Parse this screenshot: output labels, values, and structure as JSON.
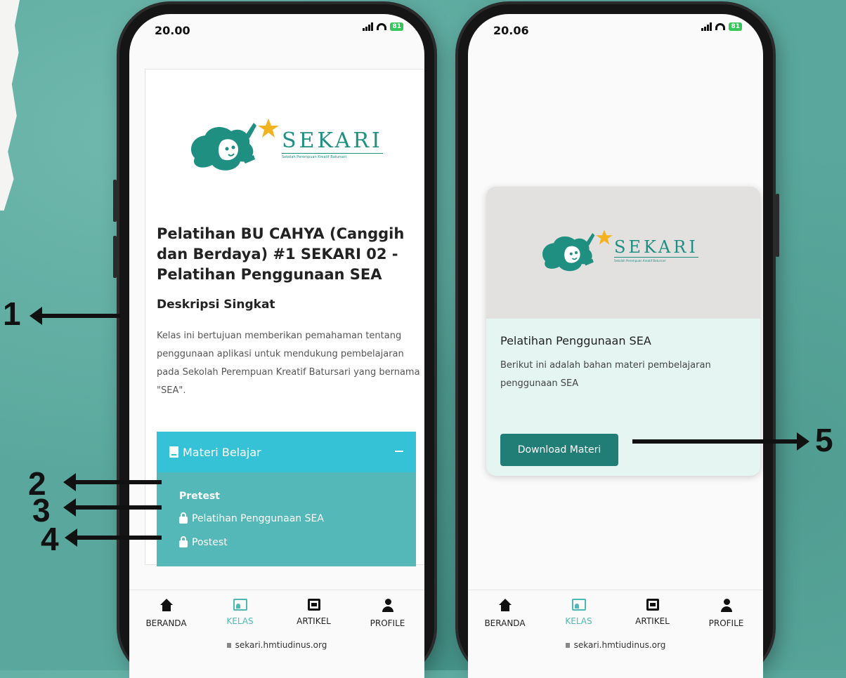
{
  "colors": {
    "background": "#5aa89d",
    "teal": "#1f8f82",
    "materi_head": "#36c2d6",
    "materi_body": "#55b8b8",
    "button": "#207e77",
    "active_nav": "#4fb8b0"
  },
  "left_phone": {
    "status_time": "20.00",
    "battery": "81",
    "logo": {
      "word": "SEKARI",
      "subtitle": "Sekolah Perempuan Kreatif Batursari"
    },
    "course_title": "Pelatihan BU CAHYA (Canggih dan Berdaya) #1 SEKARI 02 - Pelatihan Penggunaan SEA",
    "description_heading": "Deskripsi Singkat",
    "description_text": "Kelas ini bertujuan memberikan pemahaman tentang penggunaan aplikasi untuk mendukung pembelajaran pada Sekolah Perempuan Kreatif Batursari  yang bernama \"SEA\".",
    "materi": {
      "header": "Materi Belajar",
      "items": [
        {
          "label": "Pretest",
          "locked": false
        },
        {
          "label": "Pelatihan Penggunaan SEA",
          "locked": true
        },
        {
          "label": "Postest",
          "locked": true
        }
      ]
    }
  },
  "right_phone": {
    "status_time": "20.06",
    "battery": "81",
    "logo": {
      "word": "SEKARI",
      "subtitle": "Sekolah Perempuan Kreatif Batursari"
    },
    "card_title": "Pelatihan Penggunaan SEA",
    "card_description": "Berikut ini adalah bahan materi pembelajaran penggunaan SEA",
    "download_button": "Download Materi"
  },
  "nav": [
    "BERANDA",
    "KELAS",
    "ARTIKEL",
    "PROFILE"
  ],
  "url": "sekari.hmtiudinus.org",
  "annotations": [
    "1",
    "2",
    "3",
    "4",
    "5"
  ]
}
